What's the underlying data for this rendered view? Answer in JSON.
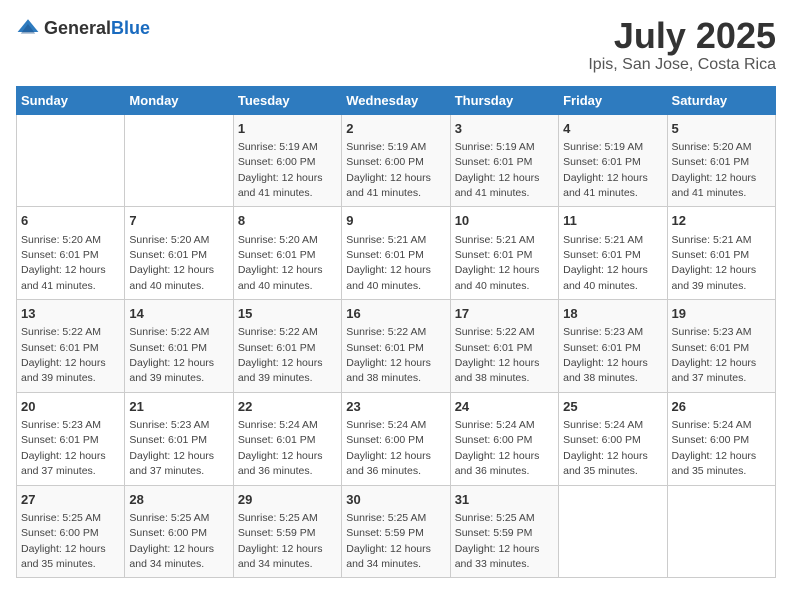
{
  "logo": {
    "general": "General",
    "blue": "Blue"
  },
  "title": "July 2025",
  "subtitle": "Ipis, San Jose, Costa Rica",
  "headers": [
    "Sunday",
    "Monday",
    "Tuesday",
    "Wednesday",
    "Thursday",
    "Friday",
    "Saturday"
  ],
  "weeks": [
    [
      {
        "day": null
      },
      {
        "day": null
      },
      {
        "day": "1",
        "sunrise": "5:19 AM",
        "sunset": "6:00 PM",
        "daylight": "12 hours and 41 minutes."
      },
      {
        "day": "2",
        "sunrise": "5:19 AM",
        "sunset": "6:00 PM",
        "daylight": "12 hours and 41 minutes."
      },
      {
        "day": "3",
        "sunrise": "5:19 AM",
        "sunset": "6:01 PM",
        "daylight": "12 hours and 41 minutes."
      },
      {
        "day": "4",
        "sunrise": "5:19 AM",
        "sunset": "6:01 PM",
        "daylight": "12 hours and 41 minutes."
      },
      {
        "day": "5",
        "sunrise": "5:20 AM",
        "sunset": "6:01 PM",
        "daylight": "12 hours and 41 minutes."
      }
    ],
    [
      {
        "day": "6",
        "sunrise": "5:20 AM",
        "sunset": "6:01 PM",
        "daylight": "12 hours and 41 minutes."
      },
      {
        "day": "7",
        "sunrise": "5:20 AM",
        "sunset": "6:01 PM",
        "daylight": "12 hours and 40 minutes."
      },
      {
        "day": "8",
        "sunrise": "5:20 AM",
        "sunset": "6:01 PM",
        "daylight": "12 hours and 40 minutes."
      },
      {
        "day": "9",
        "sunrise": "5:21 AM",
        "sunset": "6:01 PM",
        "daylight": "12 hours and 40 minutes."
      },
      {
        "day": "10",
        "sunrise": "5:21 AM",
        "sunset": "6:01 PM",
        "daylight": "12 hours and 40 minutes."
      },
      {
        "day": "11",
        "sunrise": "5:21 AM",
        "sunset": "6:01 PM",
        "daylight": "12 hours and 40 minutes."
      },
      {
        "day": "12",
        "sunrise": "5:21 AM",
        "sunset": "6:01 PM",
        "daylight": "12 hours and 39 minutes."
      }
    ],
    [
      {
        "day": "13",
        "sunrise": "5:22 AM",
        "sunset": "6:01 PM",
        "daylight": "12 hours and 39 minutes."
      },
      {
        "day": "14",
        "sunrise": "5:22 AM",
        "sunset": "6:01 PM",
        "daylight": "12 hours and 39 minutes."
      },
      {
        "day": "15",
        "sunrise": "5:22 AM",
        "sunset": "6:01 PM",
        "daylight": "12 hours and 39 minutes."
      },
      {
        "day": "16",
        "sunrise": "5:22 AM",
        "sunset": "6:01 PM",
        "daylight": "12 hours and 38 minutes."
      },
      {
        "day": "17",
        "sunrise": "5:22 AM",
        "sunset": "6:01 PM",
        "daylight": "12 hours and 38 minutes."
      },
      {
        "day": "18",
        "sunrise": "5:23 AM",
        "sunset": "6:01 PM",
        "daylight": "12 hours and 38 minutes."
      },
      {
        "day": "19",
        "sunrise": "5:23 AM",
        "sunset": "6:01 PM",
        "daylight": "12 hours and 37 minutes."
      }
    ],
    [
      {
        "day": "20",
        "sunrise": "5:23 AM",
        "sunset": "6:01 PM",
        "daylight": "12 hours and 37 minutes."
      },
      {
        "day": "21",
        "sunrise": "5:23 AM",
        "sunset": "6:01 PM",
        "daylight": "12 hours and 37 minutes."
      },
      {
        "day": "22",
        "sunrise": "5:24 AM",
        "sunset": "6:01 PM",
        "daylight": "12 hours and 36 minutes."
      },
      {
        "day": "23",
        "sunrise": "5:24 AM",
        "sunset": "6:00 PM",
        "daylight": "12 hours and 36 minutes."
      },
      {
        "day": "24",
        "sunrise": "5:24 AM",
        "sunset": "6:00 PM",
        "daylight": "12 hours and 36 minutes."
      },
      {
        "day": "25",
        "sunrise": "5:24 AM",
        "sunset": "6:00 PM",
        "daylight": "12 hours and 35 minutes."
      },
      {
        "day": "26",
        "sunrise": "5:24 AM",
        "sunset": "6:00 PM",
        "daylight": "12 hours and 35 minutes."
      }
    ],
    [
      {
        "day": "27",
        "sunrise": "5:25 AM",
        "sunset": "6:00 PM",
        "daylight": "12 hours and 35 minutes."
      },
      {
        "day": "28",
        "sunrise": "5:25 AM",
        "sunset": "6:00 PM",
        "daylight": "12 hours and 34 minutes."
      },
      {
        "day": "29",
        "sunrise": "5:25 AM",
        "sunset": "5:59 PM",
        "daylight": "12 hours and 34 minutes."
      },
      {
        "day": "30",
        "sunrise": "5:25 AM",
        "sunset": "5:59 PM",
        "daylight": "12 hours and 34 minutes."
      },
      {
        "day": "31",
        "sunrise": "5:25 AM",
        "sunset": "5:59 PM",
        "daylight": "12 hours and 33 minutes."
      },
      {
        "day": null
      },
      {
        "day": null
      }
    ]
  ]
}
